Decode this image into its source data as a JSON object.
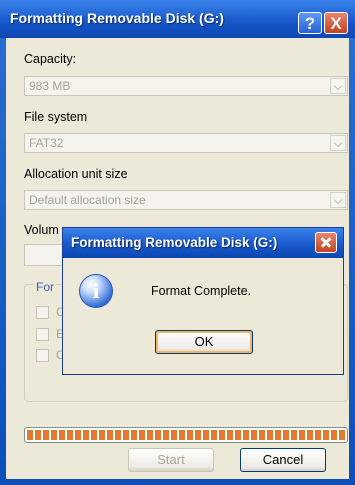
{
  "window": {
    "title": "Formatting Removable Disk (G:)",
    "help_label": "?",
    "close_label": "X"
  },
  "capacity": {
    "label": "Capacity:",
    "value": "983 MB"
  },
  "file_system": {
    "label": "File system",
    "value": "FAT32"
  },
  "allocation": {
    "label": "Allocation unit size",
    "value": "Default allocation size"
  },
  "volume": {
    "label": "Volum"
  },
  "format_options": {
    "label": "For",
    "option_1": "C",
    "option_2": "E",
    "option_3": "C"
  },
  "progress": {
    "fraction": 1.0,
    "color": "#e07a2e"
  },
  "buttons": {
    "start": "Start",
    "cancel": "Cancel"
  },
  "popup": {
    "title": "Formatting Removable Disk (G:)",
    "icon": "information-icon",
    "icon_glyph": "i",
    "message": "Format Complete.",
    "ok": "OK"
  }
}
